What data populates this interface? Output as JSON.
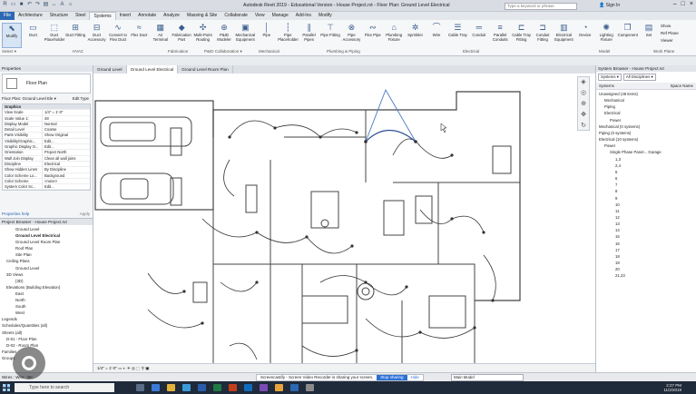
{
  "titlebar": {
    "title": "Autodesk Revit 2019 - Educational Version - House Project.rvt - Floor Plan: Ground Level Electrical",
    "search_placeholder": "Type a keyword or phrase",
    "sign_in": "Sign In"
  },
  "ribbon_tabs": [
    "File",
    "Architecture",
    "Structure",
    "Steel",
    "Systems",
    "Insert",
    "Annotate",
    "Analyze",
    "Massing & Site",
    "Collaborate",
    "View",
    "Manage",
    "Add-Ins",
    "Modify"
  ],
  "active_tab": "Systems",
  "ribbon": {
    "buttons": [
      {
        "label": "Modify",
        "icon": "cursor-icon"
      },
      {
        "label": "Duct",
        "icon": "duct-icon"
      },
      {
        "label": "Duct Placeholder",
        "icon": "duct-placeholder-icon"
      },
      {
        "label": "Duct Fitting",
        "icon": "duct-fitting-icon"
      },
      {
        "label": "Duct Accessory",
        "icon": "duct-accessory-icon"
      },
      {
        "label": "Convert to Flex Duct",
        "icon": "flex-duct-icon"
      },
      {
        "label": "Flex Duct",
        "icon": "flex-icon"
      },
      {
        "label": "Air Terminal",
        "icon": "air-terminal-icon"
      },
      {
        "label": "Fabrication Part",
        "icon": "fabrication-icon"
      },
      {
        "label": "Multi-Point Routing",
        "icon": "routing-icon"
      },
      {
        "label": "P&ID Modeler",
        "icon": "pid-icon"
      },
      {
        "label": "Mechanical Equipment",
        "icon": "mech-equipment-icon"
      },
      {
        "label": "Pipe",
        "icon": "pipe-icon"
      },
      {
        "label": "Pipe Placeholder",
        "icon": "pipe-placeholder-icon"
      },
      {
        "label": "Parallel Pipes",
        "icon": "parallel-pipes-icon"
      },
      {
        "label": "Pipe Fitting",
        "icon": "pipe-fitting-icon"
      },
      {
        "label": "Pipe Accessory",
        "icon": "pipe-accessory-icon"
      },
      {
        "label": "Flex Pipe",
        "icon": "flex-pipe-icon"
      },
      {
        "label": "Plumbing Fixture",
        "icon": "plumbing-icon"
      },
      {
        "label": "Sprinkler",
        "icon": "sprinkler-icon"
      },
      {
        "label": "Wire",
        "icon": "wire-icon"
      },
      {
        "label": "Cable Tray",
        "icon": "cable-tray-icon"
      },
      {
        "label": "Conduit",
        "icon": "conduit-icon"
      },
      {
        "label": "Parallel Conduits",
        "icon": "parallel-conduit-icon"
      },
      {
        "label": "Cable Tray Fitting",
        "icon": "tray-fitting-icon"
      },
      {
        "label": "Conduit Fitting",
        "icon": "conduit-fitting-icon"
      },
      {
        "label": "Electrical Equipment",
        "icon": "elec-equipment-icon"
      },
      {
        "label": "Device",
        "icon": "device-icon"
      },
      {
        "label": "Lighting Fixture",
        "icon": "lighting-icon"
      },
      {
        "label": "Component",
        "icon": "component-icon"
      },
      {
        "label": "Set",
        "icon": "set-icon"
      }
    ],
    "panels": [
      "Select ▾",
      "HVAC",
      "Fabrication",
      "P&ID Collaboration ▾",
      "Mechanical",
      "Plumbing & Piping",
      "Electrical",
      "Model",
      "Work Plane"
    ],
    "small_buttons": [
      "Show",
      "Ref Plane",
      "Viewer"
    ]
  },
  "doc_tabs": [
    "Ground Level",
    "Ground Level Electrical",
    "Ground Level Room Plan"
  ],
  "properties": {
    "title": "Properties",
    "type_name": "Floor Plan",
    "view_selector": "Floor Plan: Ground Level Ele ▾",
    "edit_type": "Edit Type",
    "rows": [
      {
        "k": "Graphics",
        "v": "",
        "group": true
      },
      {
        "k": "View Scale",
        "v": "1/4\" = 1'-0\""
      },
      {
        "k": "Scale Value 1:",
        "v": "48"
      },
      {
        "k": "Display Model",
        "v": "Normal"
      },
      {
        "k": "Detail Level",
        "v": "Coarse"
      },
      {
        "k": "Parts Visibility",
        "v": "Show Original"
      },
      {
        "k": "Visibility/Graphic...",
        "v": "Edit..."
      },
      {
        "k": "Graphic Display O...",
        "v": "Edit..."
      },
      {
        "k": "Orientation",
        "v": "Project North"
      },
      {
        "k": "Wall Join Display",
        "v": "Clean all wall joins"
      },
      {
        "k": "Discipline",
        "v": "Electrical"
      },
      {
        "k": "Show Hidden Lines",
        "v": "By Discipline"
      },
      {
        "k": "Color Scheme Lo...",
        "v": "Background"
      },
      {
        "k": "Color Scheme",
        "v": "<none>"
      },
      {
        "k": "System Color Sc...",
        "v": "Edit..."
      }
    ],
    "help": "Properties help",
    "apply": "Apply"
  },
  "project_browser": {
    "title": "Project Browser - House Project.rvt",
    "items": [
      {
        "label": "Ground Level",
        "indent": 3,
        "bold": false
      },
      {
        "label": "Ground Level Electrical",
        "indent": 3,
        "bold": true
      },
      {
        "label": "Ground Level Room Plan",
        "indent": 3,
        "bold": false
      },
      {
        "label": "Roof Plan",
        "indent": 3,
        "bold": false
      },
      {
        "label": "Site Plan",
        "indent": 3,
        "bold": false
      },
      {
        "label": "Ceiling Plans",
        "indent": 1,
        "bold": false
      },
      {
        "label": "Ground Level",
        "indent": 3,
        "bold": false
      },
      {
        "label": "3D Views",
        "indent": 1,
        "bold": false
      },
      {
        "label": "{3D}",
        "indent": 3,
        "bold": false
      },
      {
        "label": "Elevations (Building Elevation)",
        "indent": 1,
        "bold": false
      },
      {
        "label": "East",
        "indent": 3,
        "bold": false
      },
      {
        "label": "North",
        "indent": 3,
        "bold": false
      },
      {
        "label": "South",
        "indent": 3,
        "bold": false
      },
      {
        "label": "West",
        "indent": 3,
        "bold": false
      },
      {
        "label": "Legends",
        "indent": 0,
        "bold": false
      },
      {
        "label": "Schedules/Quantities (all)",
        "indent": 0,
        "bold": false
      },
      {
        "label": "Sheets (all)",
        "indent": 0,
        "bold": false
      },
      {
        "label": "D-01 - Floor Plan",
        "indent": 1,
        "bold": false
      },
      {
        "label": "D-02 - Room Plan",
        "indent": 1,
        "bold": false
      },
      {
        "label": "Families",
        "indent": 0,
        "bold": false
      },
      {
        "label": "Groups",
        "indent": 0,
        "bold": false
      }
    ]
  },
  "view_control_bar": "1/4\" = 1'-0\"",
  "system_browser": {
    "title": "System Browser - House Project.rvt",
    "filter1": "Systems",
    "filter2": "All Disciplines",
    "col_systems": "Systems",
    "col_space": "Space Name",
    "items": [
      {
        "label": "Unassigned (48 items)",
        "indent": 0
      },
      {
        "label": "Mechanical",
        "indent": 1
      },
      {
        "label": "Piping",
        "indent": 1
      },
      {
        "label": "Electrical",
        "indent": 1
      },
      {
        "label": "Power",
        "indent": 2
      },
      {
        "label": "Mechanical (0 systems)",
        "indent": 0
      },
      {
        "label": "Piping (0 systems)",
        "indent": 0
      },
      {
        "label": "Electrical (10 systems)",
        "indent": 0
      },
      {
        "label": "Power",
        "indent": 1
      },
      {
        "label": "Single Phase Panel...  Garage",
        "indent": 2
      },
      {
        "label": "1,3",
        "indent": 3
      },
      {
        "label": "2,4",
        "indent": 3
      },
      {
        "label": "5",
        "indent": 3
      },
      {
        "label": "6",
        "indent": 3
      },
      {
        "label": "7",
        "indent": 3
      },
      {
        "label": "8",
        "indent": 3
      },
      {
        "label": "9",
        "indent": 3
      },
      {
        "label": "10",
        "indent": 3
      },
      {
        "label": "11",
        "indent": 3
      },
      {
        "label": "12",
        "indent": 3
      },
      {
        "label": "13",
        "indent": 3
      },
      {
        "label": "14",
        "indent": 3
      },
      {
        "label": "15",
        "indent": 3
      },
      {
        "label": "16",
        "indent": 3
      },
      {
        "label": "17",
        "indent": 3
      },
      {
        "label": "18",
        "indent": 3
      },
      {
        "label": "19",
        "indent": 3
      },
      {
        "label": "20",
        "indent": 3
      },
      {
        "label": "21,23",
        "indent": 3
      }
    ]
  },
  "statusbar": {
    "left": "Wires : Wire : BK",
    "share_text": "Screencastify - Screen Video Recorder is sharing your screen.",
    "stop": "Stop sharing",
    "hide": "Hide",
    "model": "Main Model"
  },
  "taskbar": {
    "search": "Type here to search",
    "time": "2:27 PM",
    "date": "11/2/2019"
  },
  "colors": {
    "accent": "#2c67b2",
    "wire_arc": "#333333",
    "selected_wire": "#4a78c2"
  }
}
